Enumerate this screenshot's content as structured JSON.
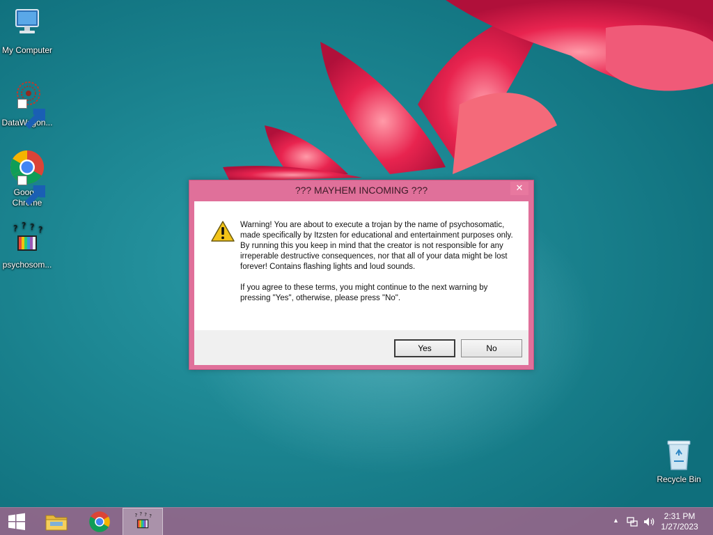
{
  "desktop": {
    "icons": [
      {
        "label": "My Computer",
        "icon": "computer-icon"
      },
      {
        "label": "DataWagon...",
        "icon": "datawagon-icon"
      },
      {
        "label": "Google Chrome",
        "icon": "chrome-icon"
      },
      {
        "label": "psychosom...",
        "icon": "psychosomatic-icon"
      },
      {
        "label": "Recycle Bin",
        "icon": "recycle-bin-icon"
      }
    ]
  },
  "dialog": {
    "title": "??? MAYHEM INCOMING ???",
    "close_glyph": "✕",
    "message_p1": "Warning! You are about to execute a trojan by the name of psychosomatic, made specifically by Itzsten for educational and entertainment purposes only. By running this you keep in mind that the creator is not responsible for any irreperable destructive consequences, nor that all of your data might be lost forever! Contains flashing lights and loud sounds.",
    "message_p2": "If you agree to these terms, you might continue to the next warning by pressing \"Yes\", otherwise, please press \"No\".",
    "yes_label": "Yes",
    "no_label": "No",
    "icon": "warning-icon"
  },
  "taskbar": {
    "items": [
      "start-icon",
      "file-explorer-icon",
      "chrome-icon",
      "psychosomatic-icon"
    ],
    "tray": {
      "chevron": "▲",
      "time": "2:31 PM",
      "date": "1/27/2023"
    }
  },
  "colors": {
    "dialog_frame": "#e0709a",
    "taskbar": "#aa648c",
    "desktop": "#1d8793"
  }
}
